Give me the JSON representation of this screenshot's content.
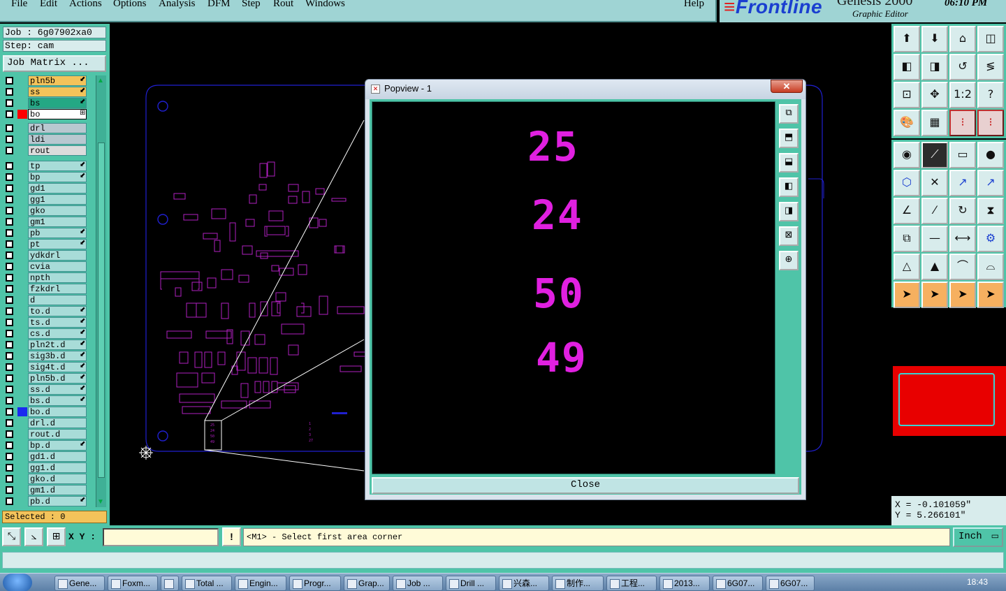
{
  "menubar": {
    "items": [
      "File",
      "Edit",
      "Actions",
      "Options",
      "Analysis",
      "DFM",
      "Step",
      "Rout",
      "Windows"
    ],
    "help": "Help"
  },
  "brand": {
    "logo": "Frontline",
    "product": "Genesis 2000",
    "subtitle": "Graphic Editor",
    "time": "06:10  PM"
  },
  "left_panel": {
    "job_label": "Job : 6g07902xa0",
    "step_label": "Step: cam",
    "job_matrix_button": "Job Matrix ...",
    "selected_status": "Selected : 0",
    "layers": [
      {
        "name": "pln5b",
        "style": "orange",
        "mark": "⬋"
      },
      {
        "name": "ss",
        "style": "orange",
        "mark": "⬋"
      },
      {
        "name": "bs",
        "style": "green",
        "mark": "⬋"
      },
      {
        "name": "bo",
        "style": "selected",
        "color": "#ff0000",
        "mark": "⊞"
      },
      {
        "name": "drl",
        "style": "dim"
      },
      {
        "name": "ldi",
        "style": "dim"
      },
      {
        "name": "rout",
        "style": "light"
      },
      {
        "name": "tp",
        "style": "normal",
        "mark": "⬋"
      },
      {
        "name": "bp",
        "style": "normal",
        "mark": "⬋"
      },
      {
        "name": "gd1",
        "style": "normal"
      },
      {
        "name": "gg1",
        "style": "normal"
      },
      {
        "name": "gko",
        "style": "normal"
      },
      {
        "name": "gm1",
        "style": "normal"
      },
      {
        "name": "pb",
        "style": "normal",
        "mark": "⬋"
      },
      {
        "name": "pt",
        "style": "normal",
        "mark": "⬋"
      },
      {
        "name": "ydkdrl",
        "style": "normal"
      },
      {
        "name": "cvia",
        "style": "normal"
      },
      {
        "name": "npth",
        "style": "normal"
      },
      {
        "name": "fzkdrl",
        "style": "normal"
      },
      {
        "name": "d",
        "style": "normal"
      },
      {
        "name": "to.d",
        "style": "normal",
        "mark": "⬋"
      },
      {
        "name": "ts.d",
        "style": "normal",
        "mark": "⬋"
      },
      {
        "name": "cs.d",
        "style": "normal",
        "mark": "⬋"
      },
      {
        "name": "pln2t.d",
        "style": "normal",
        "mark": "⬋"
      },
      {
        "name": "sig3b.d",
        "style": "normal",
        "mark": "⬋"
      },
      {
        "name": "sig4t.d",
        "style": "normal",
        "mark": "⬋"
      },
      {
        "name": "pln5b.d",
        "style": "normal",
        "mark": "⬋"
      },
      {
        "name": "ss.d",
        "style": "normal",
        "mark": "⬋"
      },
      {
        "name": "bs.d",
        "style": "normal",
        "mark": "⬋"
      },
      {
        "name": "bo.d",
        "style": "normal",
        "color": "#1a2af0"
      },
      {
        "name": "drl.d",
        "style": "normal"
      },
      {
        "name": "rout.d",
        "style": "normal"
      },
      {
        "name": "bp.d",
        "style": "normal",
        "mark": "⬋"
      },
      {
        "name": "gd1.d",
        "style": "normal"
      },
      {
        "name": "gg1.d",
        "style": "normal"
      },
      {
        "name": "gko.d",
        "style": "normal"
      },
      {
        "name": "gm1.d",
        "style": "normal"
      },
      {
        "name": "pb.d",
        "style": "normal",
        "mark": "⬋"
      }
    ]
  },
  "popview": {
    "title": "Popview - 1",
    "close_x": "✕",
    "numbers": [
      "25",
      "24",
      "50",
      "49"
    ],
    "number_color": "#e020e0",
    "close_button": "Close",
    "tools": [
      "zoom-fit-icon",
      "pan-up-icon",
      "pan-down-icon",
      "pan-left-icon",
      "pan-right-icon",
      "zoom-out-icon",
      "zoom-in-icon"
    ]
  },
  "bottom": {
    "xy_label": "X Y :",
    "xy_value": "",
    "prompt_button": "!",
    "prompt_text": "<M1> - Select first area corner",
    "units": "Inch"
  },
  "coords": {
    "x": "X = -0.101059\"",
    "y": "Y =  5.266101\""
  },
  "taskbar": {
    "items": [
      "Gene...",
      "Foxm...",
      "",
      "Total ...",
      "Engin...",
      "Progr...",
      "Grap...",
      "Job ...",
      "Drill ...",
      "兴森...",
      "制作...",
      "工程...",
      "2013...",
      "6G07...",
      "6G07..."
    ],
    "clock": "18:43"
  },
  "colors": {
    "panel": "#4fc4a8",
    "menu": "#9fd4d4",
    "board_outline": "#2020d0",
    "artwork": "#b020c0"
  }
}
